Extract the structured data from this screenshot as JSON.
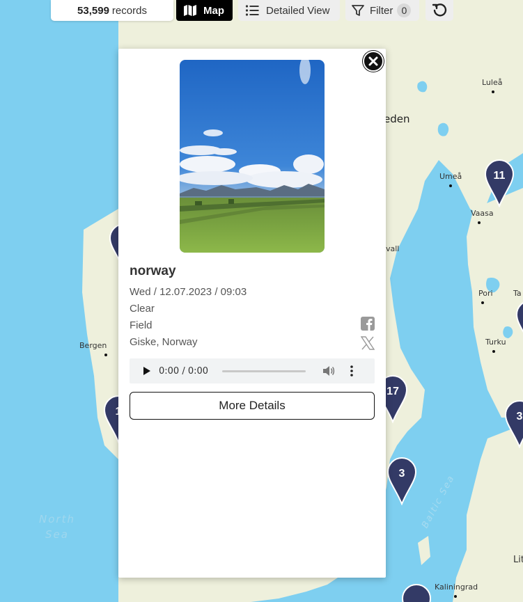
{
  "toolbar": {
    "records_count": "53,599",
    "records_label": "records",
    "map_label": "Map",
    "detail_label": "Detailed View",
    "filter_label": "Filter",
    "filter_count": "0"
  },
  "map": {
    "places": {
      "lulea": "Luleå",
      "sweden": "eden",
      "umea": "Umeå",
      "vaasa": "Vaasa",
      "gavle": "vall",
      "pori": "Pori",
      "ta": "Ta",
      "bergen": "Bergen",
      "turku": "Turku",
      "kaliningrad": "Kaliningrad",
      "lit": "Lit"
    },
    "seas": {
      "north_sea_line1": "North",
      "north_sea_line2": "Sea",
      "baltic": "Baltic Sea"
    },
    "clusters": [
      {
        "label": "11"
      },
      {
        "label": "17"
      },
      {
        "label": "3"
      },
      {
        "label": "3"
      },
      {
        "label": "1"
      },
      {
        "label": ""
      },
      {
        "label": ""
      },
      {
        "label": ""
      }
    ],
    "colors": {
      "water": "#7ecff0",
      "land": "#eef0dc",
      "cluster": "#333a66"
    }
  },
  "popup": {
    "title": "norway",
    "datetime": "Wed / 12.07.2023 / 09:03",
    "weather": "Clear",
    "habitat": "Field",
    "location": "Giske, Norway",
    "audio_time": "0:00 / 0:00",
    "more_details_label": "More Details"
  }
}
